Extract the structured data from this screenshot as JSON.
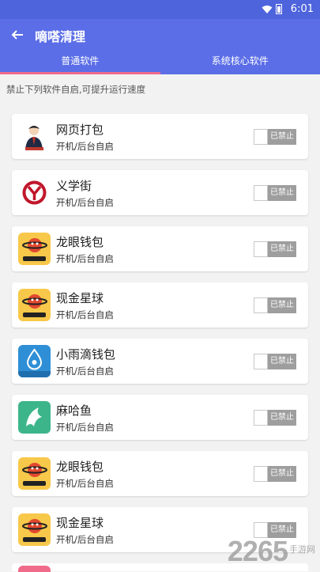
{
  "status": {
    "time": "6:01"
  },
  "header": {
    "title": "嘀嗒清理"
  },
  "tabs": [
    {
      "label": "普通软件",
      "active": true
    },
    {
      "label": "系统核心软件",
      "active": false
    }
  ],
  "hint": "禁止下列软件自启,可提升运行速度",
  "apps": [
    {
      "name": "网页打包",
      "sub": "开机/后台自启",
      "toggle": "已禁止",
      "icon": "person-avatar-icon"
    },
    {
      "name": "义学街",
      "sub": "开机/后台自启",
      "toggle": "已禁止",
      "icon": "y-logo-icon"
    },
    {
      "name": "龙眼钱包",
      "sub": "开机/后台自启",
      "toggle": "已禁止",
      "icon": "planet-mascot-icon"
    },
    {
      "name": "现金星球",
      "sub": "开机/后台自启",
      "toggle": "已禁止",
      "icon": "planet-mascot-icon"
    },
    {
      "name": "小雨滴钱包",
      "sub": "开机/后台自启",
      "toggle": "已禁止",
      "icon": "raindrop-icon"
    },
    {
      "name": "麻哈鱼",
      "sub": "开机/后台自启",
      "toggle": "已禁止",
      "icon": "fish-icon"
    },
    {
      "name": "龙眼钱包",
      "sub": "开机/后台自启",
      "toggle": "已禁止",
      "icon": "planet-mascot-icon"
    },
    {
      "name": "现金星球",
      "sub": "开机/后台自启",
      "toggle": "已禁止",
      "icon": "planet-mascot-icon"
    }
  ],
  "watermark": {
    "number": "2265",
    "site": "手游网"
  },
  "colors": {
    "appbar": "#5b6ee8",
    "tab_indicator": "#f06a8a",
    "toggle": "#9e9e9e"
  }
}
